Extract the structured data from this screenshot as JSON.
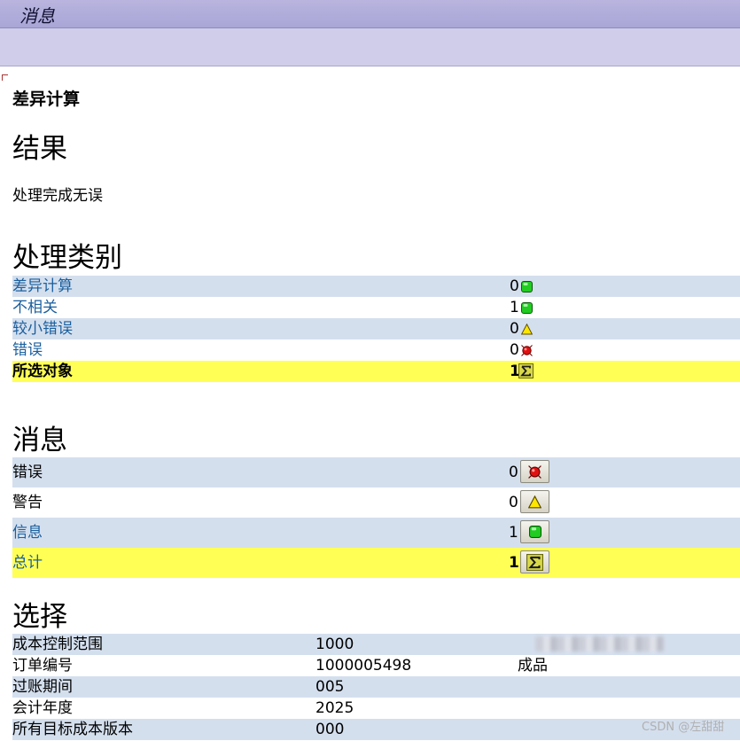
{
  "window": {
    "title": "消息"
  },
  "section_title": "差异计算",
  "result": {
    "heading": "结果",
    "text": "处理完成无误"
  },
  "categories": {
    "heading": "处理类别",
    "rows": [
      {
        "label": "差异计算",
        "count": "0",
        "status": "green",
        "icon": "green-light-icon"
      },
      {
        "label": "不相关",
        "count": "1",
        "status": "green",
        "icon": "green-light-icon"
      },
      {
        "label": "较小错误",
        "count": "0",
        "status": "yellow",
        "icon": "yellow-triangle-icon"
      },
      {
        "label": "错误",
        "count": "0",
        "status": "red",
        "icon": "red-light-icon"
      }
    ],
    "total": {
      "label": "所选对象",
      "count": "1",
      "icon": "sigma-icon"
    }
  },
  "messages": {
    "heading": "消息",
    "rows": [
      {
        "label": "错误",
        "count": "0",
        "icon": "red-light-icon"
      },
      {
        "label": "警告",
        "count": "0",
        "icon": "yellow-triangle-icon"
      },
      {
        "label": "信息",
        "count": "1",
        "icon": "green-light-icon"
      }
    ],
    "total": {
      "label": "总计",
      "count": "1",
      "icon": "sigma-icon"
    }
  },
  "selection": {
    "heading": "选择",
    "rows": [
      {
        "label": "成本控制范围",
        "value": "1000",
        "extra": ""
      },
      {
        "label": "订单编号",
        "value": "1000005498",
        "extra": "成品"
      },
      {
        "label": "过账期间",
        "value": "005",
        "extra": ""
      },
      {
        "label": "会计年度",
        "value": "2025",
        "extra": ""
      },
      {
        "label": "所有目标成本版本",
        "value": "000",
        "extra": ""
      }
    ]
  },
  "watermark": "CSDN @左甜甜",
  "colors": {
    "row_alt": "#d4dfee",
    "highlight": "#ffff55",
    "link": "#1a5f9e",
    "status_green": "#22cc22",
    "status_yellow": "#ffe600",
    "status_red": "#e01010"
  }
}
